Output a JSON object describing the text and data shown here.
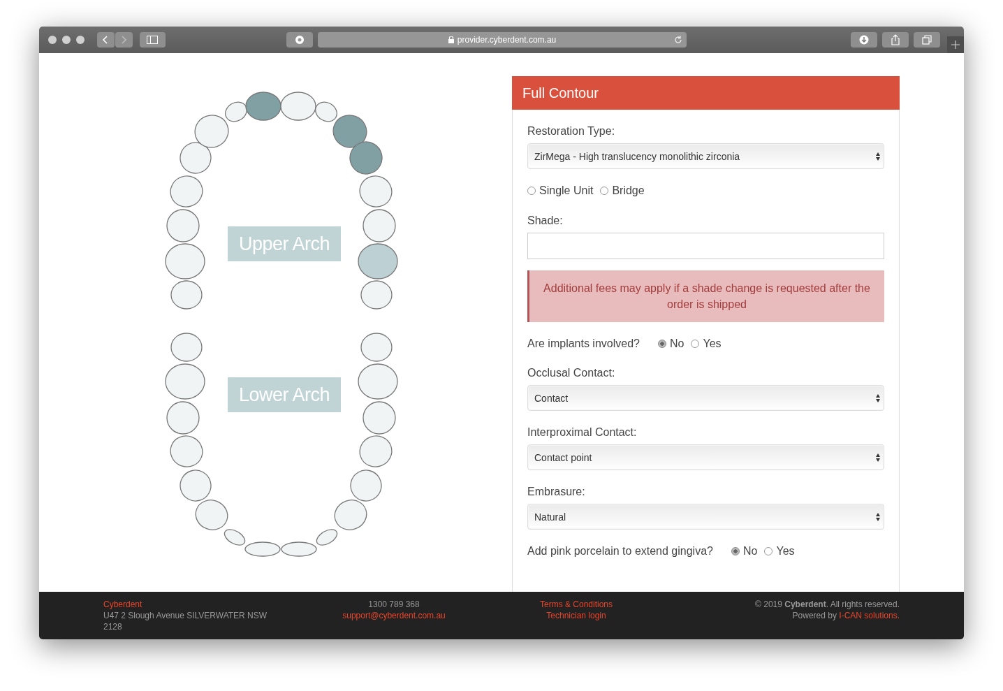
{
  "browser": {
    "url": "provider.cyberdent.com.au"
  },
  "upper_arch": {
    "label": "Upper Arch",
    "teeth": [
      {
        "selected": false,
        "highlighted": false
      },
      {
        "selected": false,
        "highlighted": false
      },
      {
        "selected": false,
        "highlighted": false
      },
      {
        "selected": false,
        "highlighted": false
      },
      {
        "selected": false,
        "highlighted": false
      },
      {
        "selected": false,
        "highlighted": false
      },
      {
        "selected": false,
        "highlighted": false
      },
      {
        "selected": true,
        "highlighted": false
      },
      {
        "selected": false,
        "highlighted": false
      },
      {
        "selected": false,
        "highlighted": false
      },
      {
        "selected": true,
        "highlighted": false
      },
      {
        "selected": true,
        "highlighted": false
      },
      {
        "selected": false,
        "highlighted": false
      },
      {
        "selected": false,
        "highlighted": false
      },
      {
        "selected": false,
        "highlighted": true
      },
      {
        "selected": false,
        "highlighted": false
      }
    ]
  },
  "lower_arch": {
    "label": "Lower Arch",
    "teeth": [
      {
        "selected": false,
        "highlighted": false
      },
      {
        "selected": false,
        "highlighted": false
      },
      {
        "selected": false,
        "highlighted": false
      },
      {
        "selected": false,
        "highlighted": false
      },
      {
        "selected": false,
        "highlighted": false
      },
      {
        "selected": false,
        "highlighted": false
      },
      {
        "selected": false,
        "highlighted": false
      },
      {
        "selected": false,
        "highlighted": false
      },
      {
        "selected": false,
        "highlighted": false
      },
      {
        "selected": false,
        "highlighted": false
      },
      {
        "selected": false,
        "highlighted": false
      },
      {
        "selected": false,
        "highlighted": false
      },
      {
        "selected": false,
        "highlighted": false
      },
      {
        "selected": false,
        "highlighted": false
      },
      {
        "selected": false,
        "highlighted": false
      },
      {
        "selected": false,
        "highlighted": false
      }
    ]
  },
  "form": {
    "title": "Full Contour",
    "fields": [
      {
        "kind": "select",
        "label": "Restoration Type:",
        "value": "ZirMega - High translucency monolithic zirconia"
      },
      {
        "kind": "radio",
        "options": [
          {
            "label": "Single Unit",
            "selected": false
          },
          {
            "label": "Bridge",
            "selected": false
          }
        ]
      },
      {
        "kind": "text",
        "label": "Shade:"
      },
      {
        "kind": "alert",
        "text": "Additional fees may apply if a shade change is requested after the order is shipped"
      },
      {
        "kind": "inline_radio",
        "label": "Are implants involved?",
        "options": [
          {
            "label": "No",
            "selected": true
          },
          {
            "label": "Yes",
            "selected": false
          }
        ]
      },
      {
        "kind": "select",
        "label": "Occlusal Contact:",
        "value": "Contact"
      },
      {
        "kind": "select",
        "label": "Interproximal Contact:",
        "value": "Contact point"
      },
      {
        "kind": "select",
        "label": "Embrasure:",
        "value": "Natural"
      },
      {
        "kind": "inline_radio",
        "label": "Add pink porcelain to extend gingiva?",
        "options": [
          {
            "label": "No",
            "selected": true
          },
          {
            "label": "Yes",
            "selected": false
          }
        ]
      }
    ]
  },
  "footer": {
    "company": "Cyberdent",
    "address": "U47 2 Slough Avenue SILVERWATER NSW 2128",
    "phone": "1300 789 368",
    "email": "support@cyberdent.com.au",
    "links": [
      "Terms & Conditions",
      "Technician login"
    ],
    "copyright": "© 2019 **Cyberdent**. All rights reserved.",
    "powered_by": "Powered by",
    "powered_by_link": "I-CAN solutions."
  }
}
